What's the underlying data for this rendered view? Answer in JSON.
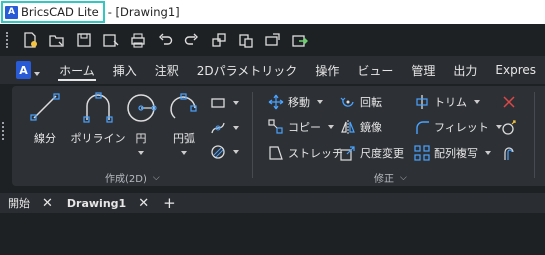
{
  "title_bar": {
    "app_name": "BricsCAD Lite",
    "document_title": "- [Drawing1]"
  },
  "quick_access": {
    "icons": [
      "new-file-icon",
      "open-file-icon",
      "save-icon",
      "save-as-icon",
      "print-icon",
      "undo-icon",
      "redo-icon",
      "copy-clip-icon",
      "paste-icon",
      "cloud-upload-icon",
      "export-icon"
    ]
  },
  "ribbon_tabs": {
    "logo_label": "A",
    "items": [
      "ホーム",
      "挿入",
      "注釈",
      "2Dパラメトリック",
      "操作",
      "ビュー",
      "管理",
      "出力",
      "Expres"
    ],
    "active_index": 0
  },
  "draw_panel": {
    "line_label": "線分",
    "polyline_label": "ポリライン",
    "circle_label": "円",
    "arc_label": "円弧",
    "panel_label": "作成(2D)"
  },
  "modify_panel": {
    "move_label": "移動",
    "rotate_label": "回転",
    "trim_label": "トリム",
    "copy_label": "コピー",
    "mirror_label": "鏡像",
    "fillet_label": "フィレット",
    "stretch_label": "ストレッチ",
    "scale_label": "尺度変更",
    "array_label": "配列複写",
    "panel_label": "修正"
  },
  "doc_tabs": [
    {
      "label": "開始",
      "active": false
    },
    {
      "label": "Drawing1",
      "active": true
    }
  ],
  "colors": {
    "accent": "#2a5bd7",
    "title_focus": "#34c6c2",
    "icon_blue": "#4aa3ff",
    "delete_red": "#e04848",
    "ribbon_bg": "#2d3035",
    "app_bg": "#1e2124"
  }
}
